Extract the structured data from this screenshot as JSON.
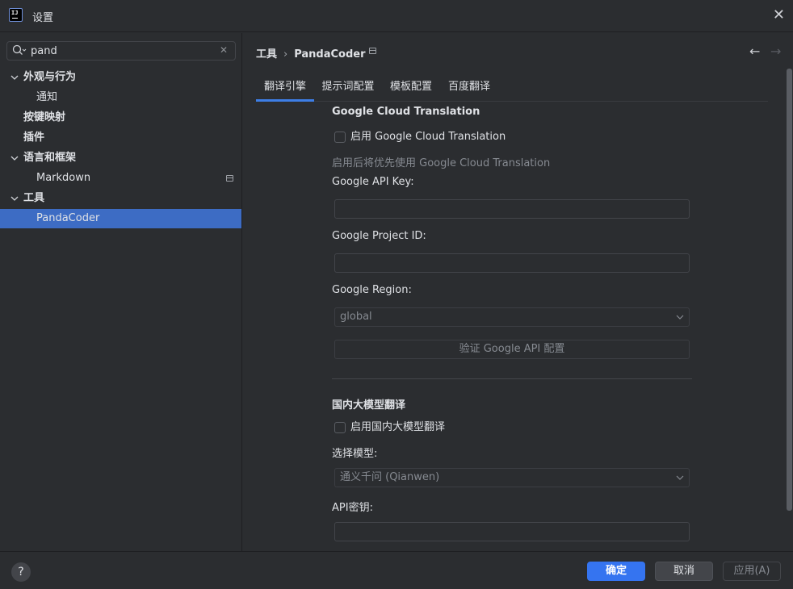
{
  "window": {
    "title": "设置",
    "close_glyph": "✕"
  },
  "search": {
    "value": "pand",
    "placeholder": "",
    "clear_glyph": "✕"
  },
  "sidebar": {
    "items": [
      {
        "label": "外观与行为",
        "expanded": true
      },
      {
        "label": "通知"
      },
      {
        "label": "按键映射"
      },
      {
        "label": "插件"
      },
      {
        "label": "语言和框架",
        "expanded": true
      },
      {
        "label": "Markdown"
      },
      {
        "label": "工具",
        "expanded": true
      },
      {
        "label": "PandaCoder",
        "selected": true
      }
    ]
  },
  "breadcrumb": {
    "parent": "工具",
    "separator": "›",
    "current": "PandaCoder"
  },
  "nav": {
    "back": "←",
    "forward": "→"
  },
  "tabs": [
    {
      "label": "翻译引擎",
      "active": true
    },
    {
      "label": "提示词配置"
    },
    {
      "label": "模板配置"
    },
    {
      "label": "百度翻译"
    }
  ],
  "google": {
    "title": "Google Cloud Translation",
    "enable_label": "启用 Google Cloud Translation",
    "enabled": false,
    "hint": "启用后将优先使用 Google Cloud Translation",
    "api_key_label": "Google API Key:",
    "api_key_value": "",
    "project_id_label": "Google Project ID:",
    "project_id_value": "",
    "region_label": "Google Region:",
    "region_value": "global",
    "verify_button": "验证 Google API 配置"
  },
  "domestic": {
    "title": "国内大模型翻译",
    "enable_label": "启用国内大模型翻译",
    "enabled": false,
    "model_label": "选择模型:",
    "model_value": "通义千问 (Qianwen)",
    "api_key_label": "API密钥:",
    "api_key_value": ""
  },
  "footer": {
    "help": "?",
    "ok": "确定",
    "cancel": "取消",
    "apply": "应用(A)"
  },
  "colors": {
    "accent": "#3574f0",
    "selection": "#3d6cc4",
    "background": "#2b2d30"
  }
}
